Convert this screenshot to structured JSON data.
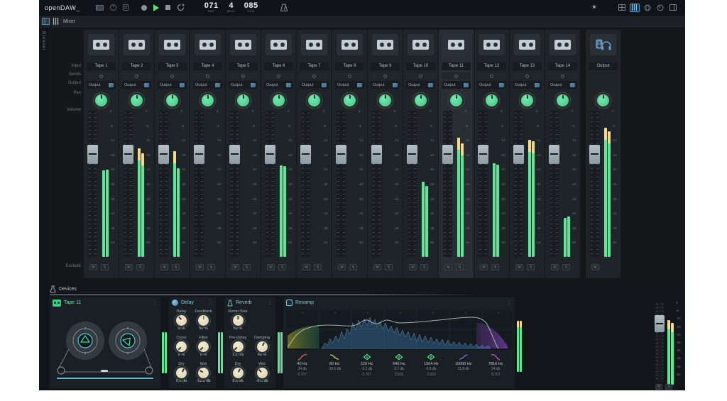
{
  "topbar": {
    "logo": "openDAW",
    "logo_cursor": "_",
    "transport": {
      "record": "record",
      "play": "play",
      "stop": "stop",
      "loop": "loop"
    },
    "position": {
      "bar": "071",
      "bar_label": "BAR",
      "beat": "4",
      "beat_label": "BEAT",
      "bpm": "085",
      "bpm_label": "BPM"
    }
  },
  "tabbar": {
    "mixer_label": "Mixer"
  },
  "sidebar": {
    "browser_label": "Browser"
  },
  "mixer": {
    "row_labels": {
      "input": "Input",
      "sends": "Sends",
      "output": "Output",
      "pan": "Pan",
      "volume": "Volume",
      "exclude": "Exclude"
    },
    "output_selector_label": "Output",
    "mute_label": "M",
    "solo_label": "S",
    "scale": [
      "0",
      "-6",
      "-12",
      "-18",
      "-24",
      "-30",
      "-36",
      "-42",
      "-48",
      "-54"
    ],
    "channels": [
      {
        "name": "Tape 1",
        "meter_l": -24.5,
        "meter_r": -24.2
      },
      {
        "name": "Tape 2",
        "meter_l": -15.5,
        "meter_r": -17.5
      },
      {
        "name": "Tape 3",
        "meter_l": -16.5,
        "meter_r": -23.5
      },
      {
        "name": "Tape 4",
        "meter_l": -60,
        "meter_r": -60
      },
      {
        "name": "Tape 5",
        "meter_l": -60,
        "meter_r": -60
      },
      {
        "name": "Tape 6",
        "meter_l": -22.5,
        "meter_r": -22.8
      },
      {
        "name": "Tape 7",
        "meter_l": -60,
        "meter_r": -60
      },
      {
        "name": "Tape 8",
        "meter_l": -60,
        "meter_r": -60
      },
      {
        "name": "Tape 9",
        "meter_l": -60,
        "meter_r": -60
      },
      {
        "name": "Tape 10",
        "meter_l": -29,
        "meter_r": -31
      },
      {
        "name": "Tape 11",
        "meter_l": -11,
        "meter_r": -13.5,
        "selected": true
      },
      {
        "name": "Tape 12",
        "meter_l": -21.5,
        "meter_r": -22
      },
      {
        "name": "Tape 13",
        "meter_l": -12,
        "meter_r": -12.5
      },
      {
        "name": "Tape 14",
        "meter_l": -44,
        "meter_r": -43.5
      },
      {
        "name": "Output",
        "meter_l": -7,
        "meter_r": -8.5,
        "master": true
      }
    ]
  },
  "devices": {
    "panel_title": "Devices",
    "channel_device": {
      "name": "Tape 11"
    },
    "delay": {
      "name": "Delay",
      "params": [
        {
          "label": "Delay",
          "value": "3/16",
          "rot": -40
        },
        {
          "label": "Feedback",
          "value": "50 %",
          "rot": 0
        },
        {
          "label": "Cross",
          "value": "0 %",
          "rot": -135
        },
        {
          "label": "Filter",
          "value": "0 %",
          "rot": -135
        },
        {
          "label": "Dry",
          "value": "0.0 db",
          "rot": 25
        },
        {
          "label": "Wet",
          "value": "-12.0 db",
          "rot": -60
        }
      ]
    },
    "reverb": {
      "name": "Reverb",
      "params": [
        {
          "label": "Room-Size",
          "value": "50 %",
          "rot": 0
        },
        null,
        {
          "label": "Pre-Delay",
          "value": "1.0 ms",
          "rot": -135
        },
        {
          "label": "Damping",
          "value": "60 %",
          "rot": 25
        },
        {
          "label": "Dry",
          "value": "0.0 db",
          "rot": 25
        },
        {
          "label": "Wet",
          "value": "-9.0 db",
          "rot": -45
        }
      ]
    },
    "revamp": {
      "name": "Revamp",
      "bands": [
        {
          "type": "highpass",
          "freq": "40 Hz",
          "gain": "24 db",
          "q": "0.707",
          "color": "#e0645c"
        },
        {
          "type": "lowshelf",
          "freq": "80 Hz",
          "gain": "-19.6 db",
          "q": "",
          "color": "#d8c850"
        },
        {
          "type": "bell",
          "freq": "120 Hz",
          "gain": "-3.1 db",
          "q": "0.707",
          "color": "#50d890"
        },
        {
          "type": "bell",
          "freq": "640 Hz",
          "gain": "9.7 db",
          "q": "3.825",
          "color": "#50d890"
        },
        {
          "type": "bell",
          "freq": "1504 Hz",
          "gain": "6.0 db",
          "q": "2.319",
          "color": "#50d890"
        },
        {
          "type": "highshelf",
          "freq": "10000 Hz",
          "gain": "11.8 db",
          "q": "",
          "color": "#7a6ae0"
        },
        {
          "type": "lowpass",
          "freq": "7816 Hz",
          "gain": "24 db",
          "q": "0.707",
          "color": "#b060d8"
        }
      ]
    },
    "strip": {
      "meter_l": -11,
      "meter_r": -13.5,
      "mute_label": "M",
      "solo_label": "S"
    }
  },
  "icons": {
    "top_left": [
      "piano-icon",
      "help-icon",
      "clipboard-icon"
    ],
    "transport": [
      "record-icon",
      "play-icon",
      "stop-icon",
      "loop-icon",
      "metronome-icon"
    ],
    "top_right": [
      "brightness-icon",
      "grid-view-icon",
      "mixer-view-icon",
      "sphere-icon",
      "knob-icon",
      "panel-icon"
    ]
  },
  "colors": {
    "accent_green": "#5ce695",
    "meter_tip": "#f2dc8c",
    "accent_blue": "#7ec8e0",
    "chain_teal": "#2ec8c0"
  }
}
